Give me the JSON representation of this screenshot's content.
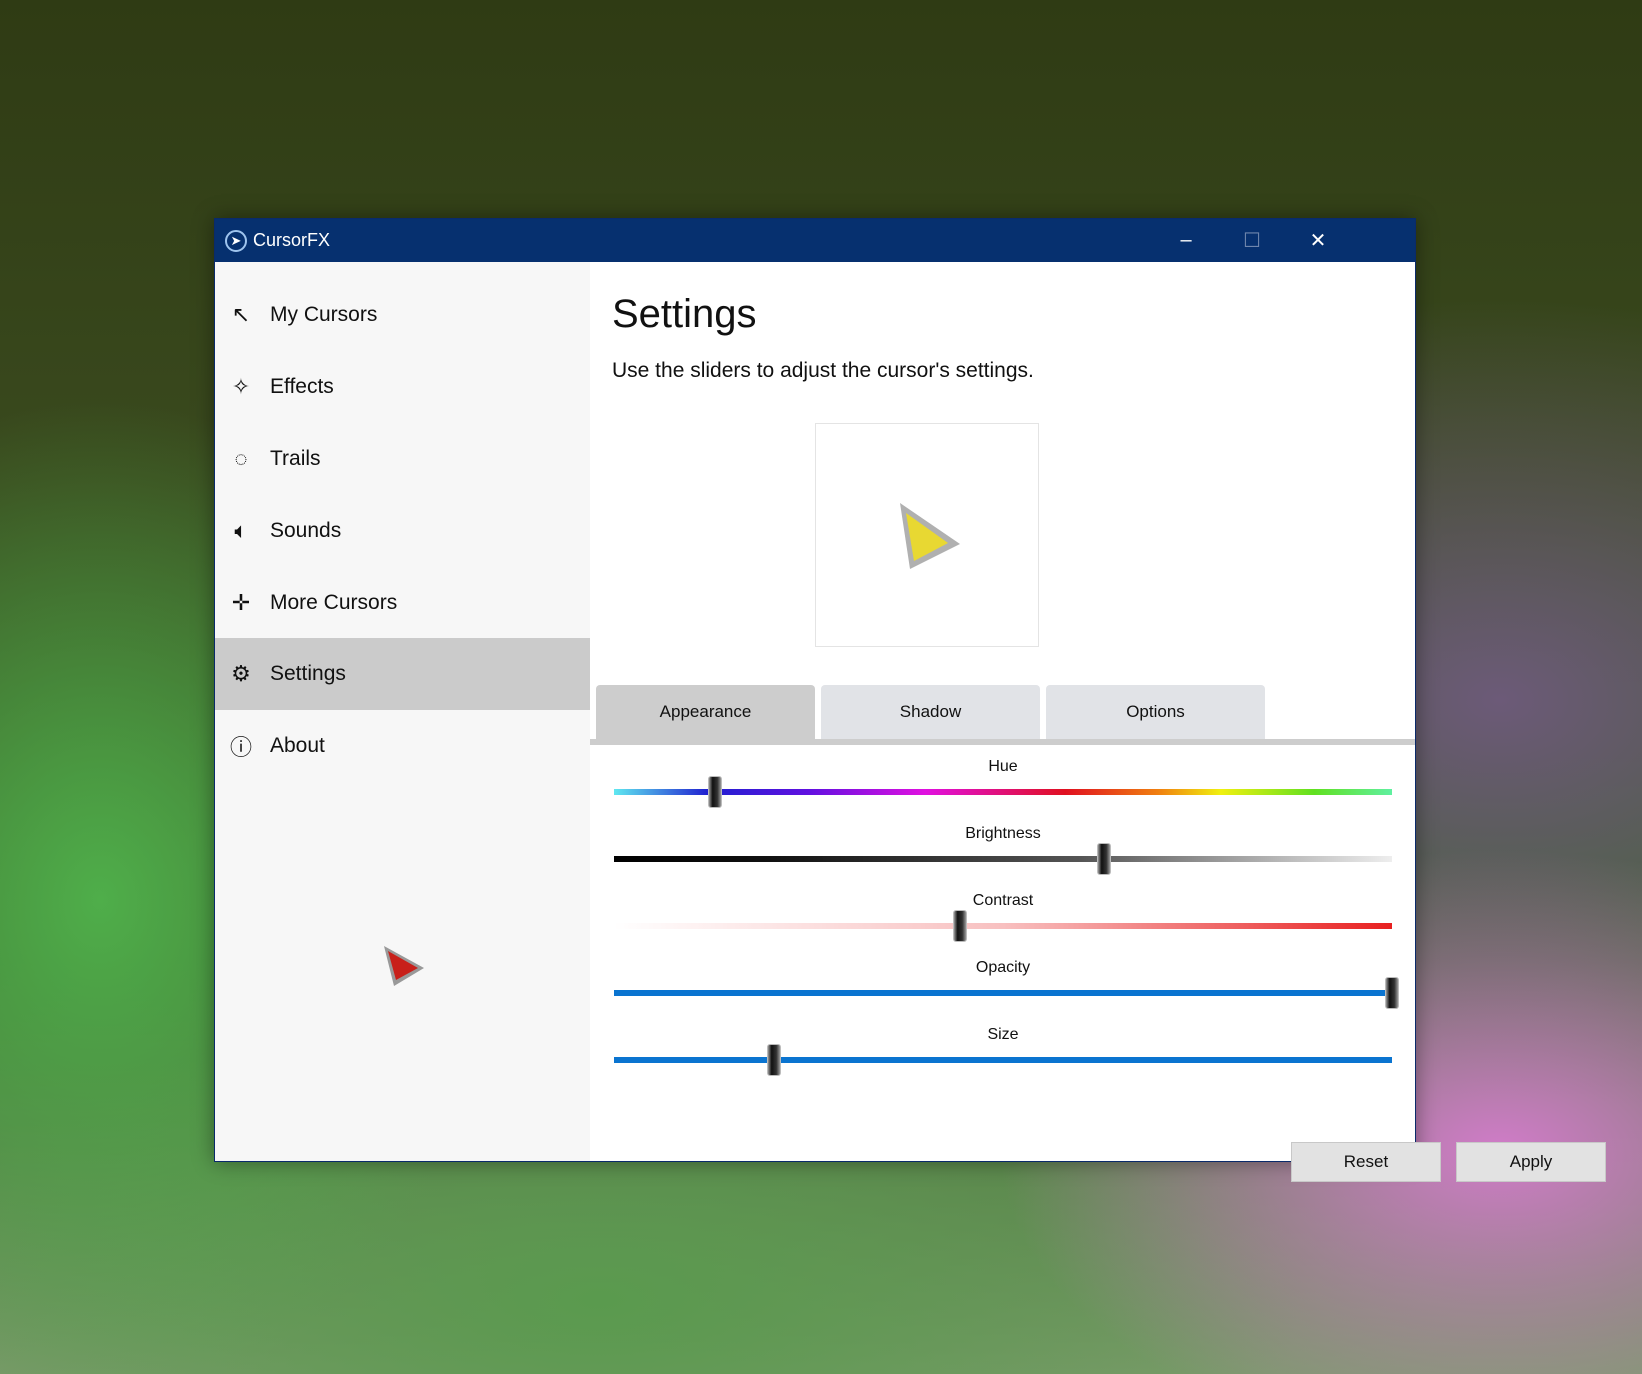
{
  "window": {
    "title": "CursorFX"
  },
  "sidebar": {
    "items": [
      {
        "label": "My Cursors",
        "icon": "arrow-cursor-icon",
        "glyph": "↖"
      },
      {
        "label": "Effects",
        "icon": "magic-wand-icon",
        "glyph": "✧"
      },
      {
        "label": "Trails",
        "icon": "trails-icon",
        "glyph": "◌"
      },
      {
        "label": "Sounds",
        "icon": "speaker-icon",
        "glyph": "🔈︎"
      },
      {
        "label": "More Cursors",
        "icon": "move-icon",
        "glyph": "✛"
      },
      {
        "label": "Settings",
        "icon": "gear-icon",
        "glyph": "⚙"
      },
      {
        "label": "About",
        "icon": "info-icon",
        "glyph": "ⓘ"
      }
    ],
    "active": 5
  },
  "main": {
    "title": "Settings",
    "subtitle": "Use the sliders to adjust the cursor's settings.",
    "tabs": [
      "Appearance",
      "Shadow",
      "Options"
    ],
    "active_tab": 0,
    "sliders": [
      {
        "label": "Hue",
        "value": 0.13
      },
      {
        "label": "Brightness",
        "value": 0.63
      },
      {
        "label": "Contrast",
        "value": 0.445
      },
      {
        "label": "Opacity",
        "value": 1.0
      },
      {
        "label": "Size",
        "value": 0.206
      }
    ],
    "reset_label": "Reset",
    "apply_label": "Apply"
  },
  "colors": {
    "titlebar": "#06306f",
    "accent": "#0a74d0"
  }
}
